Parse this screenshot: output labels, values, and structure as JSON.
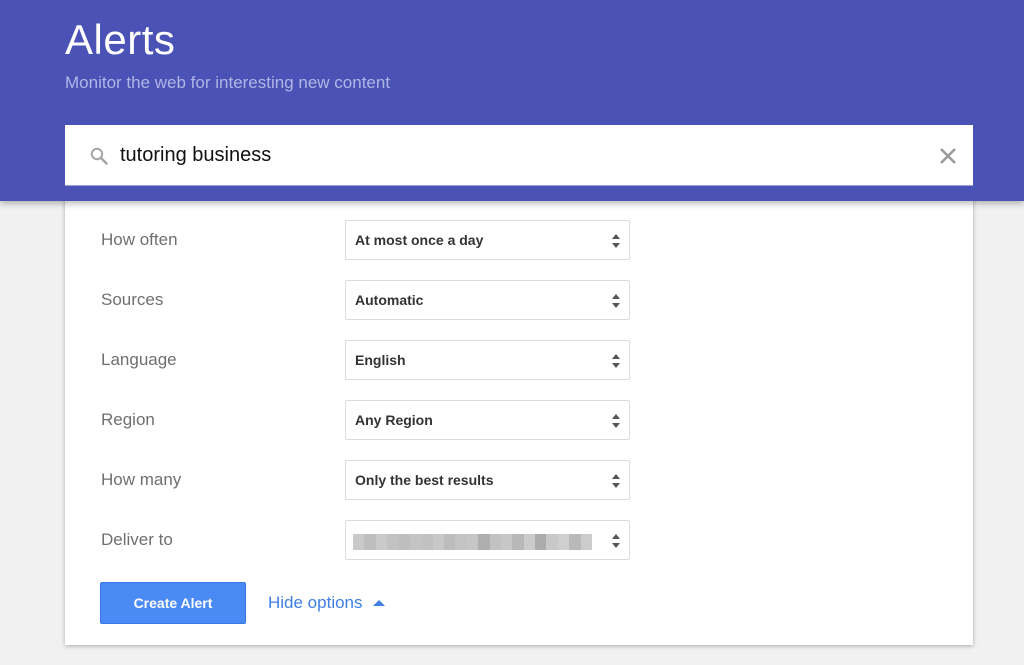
{
  "header": {
    "title": "Alerts",
    "subtitle": "Monitor the web for interesting new content"
  },
  "search": {
    "value": "tutoring business",
    "icon": "search-icon",
    "clear_icon": "close-icon"
  },
  "options": [
    {
      "label": "How often",
      "value": "At most once a day"
    },
    {
      "label": "Sources",
      "value": "Automatic"
    },
    {
      "label": "Language",
      "value": "English"
    },
    {
      "label": "Region",
      "value": "Any Region"
    },
    {
      "label": "How many",
      "value": "Only the best results"
    },
    {
      "label": "Deliver to",
      "value": "",
      "redacted": true
    }
  ],
  "actions": {
    "create_label": "Create Alert",
    "hide_options_label": "Hide options"
  },
  "colors": {
    "header_bg": "#4a53b5",
    "button_bg": "#4a8af4",
    "link": "#3f7fe5"
  }
}
